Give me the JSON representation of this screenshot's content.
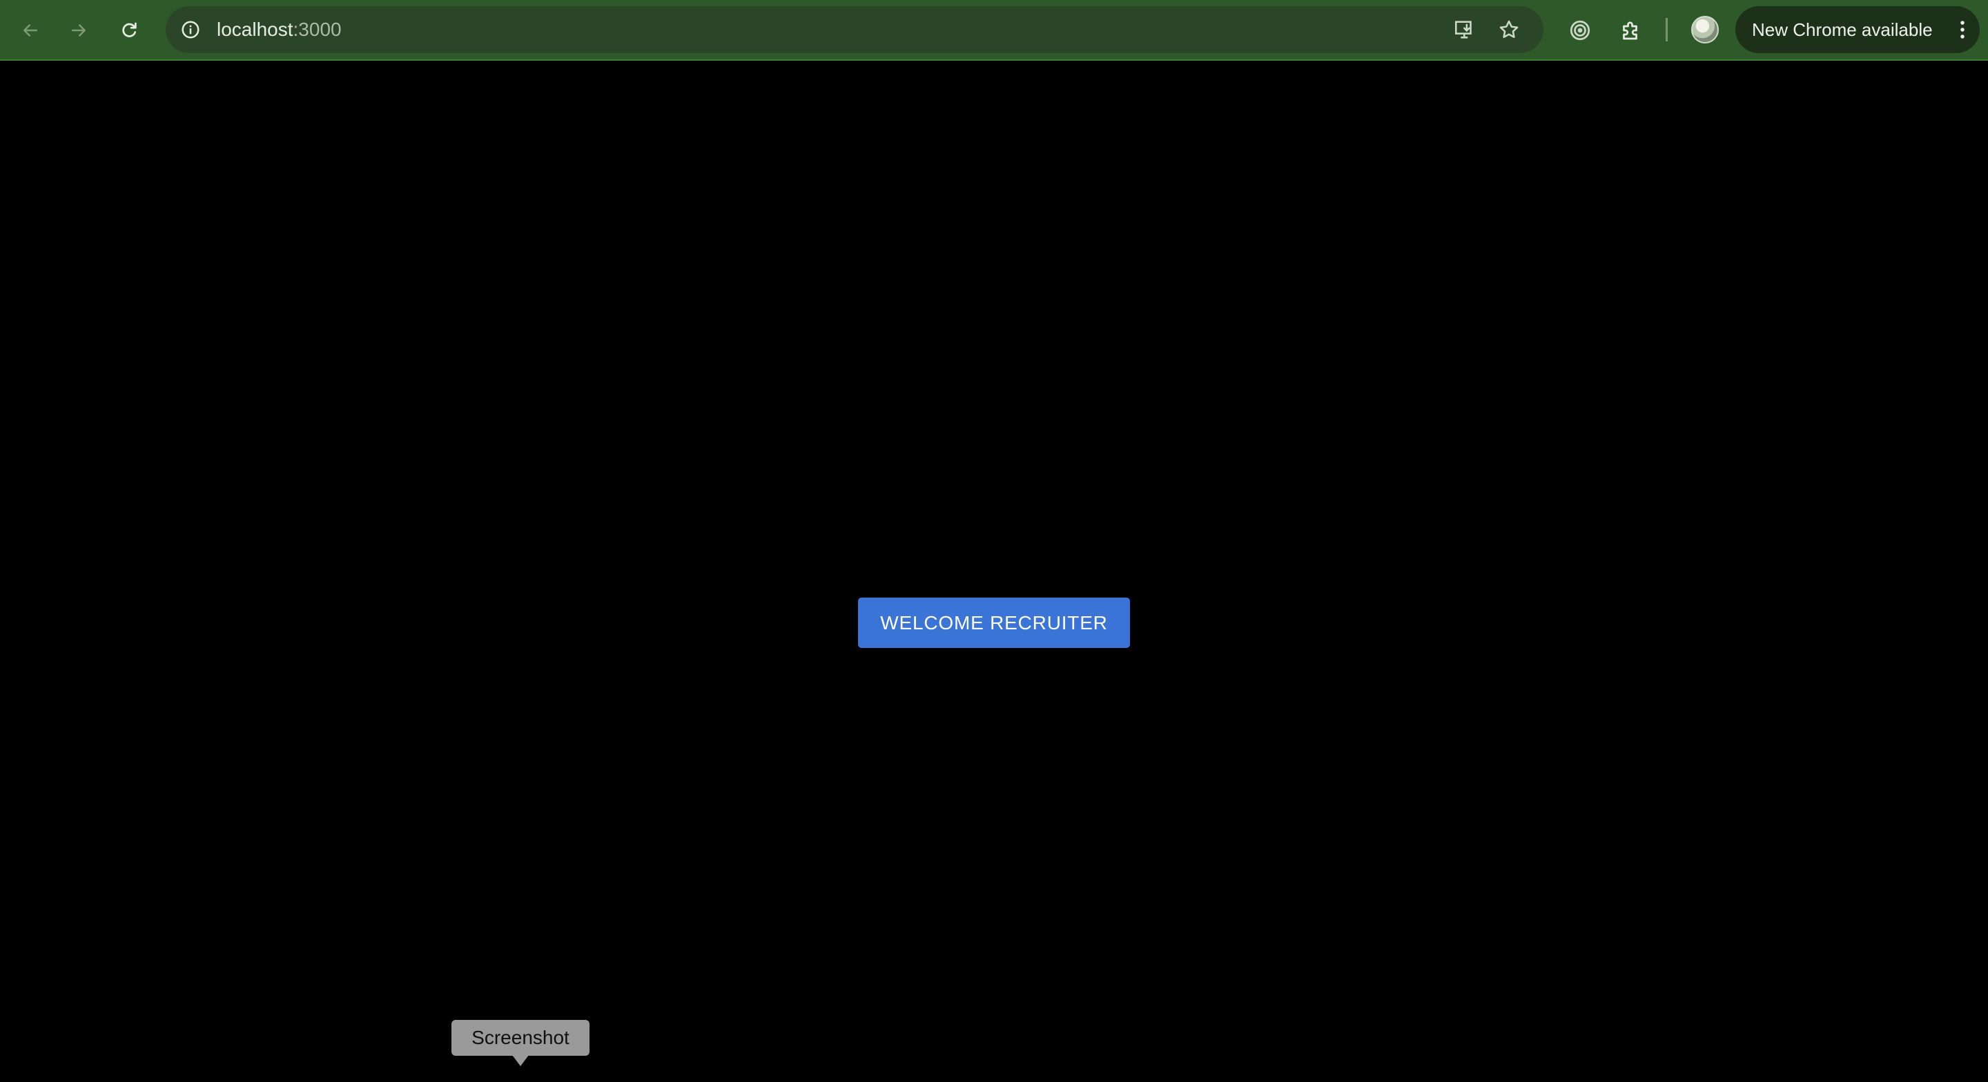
{
  "browser": {
    "url_host": "localhost",
    "url_port": ":3000",
    "update_label": "New Chrome available",
    "toolbar_color": "#2e5a2a",
    "icons": {
      "back": "back-arrow-icon",
      "forward": "forward-arrow-icon",
      "reload": "reload-icon",
      "site_info": "site-info-icon",
      "install": "install-app-icon",
      "bookmark": "bookmark-star-icon",
      "lens": "google-lens-icon",
      "extensions": "extensions-puzzle-icon",
      "menu": "kebab-menu-icon"
    }
  },
  "page": {
    "background": "#000000",
    "welcome_button_label": "WELCOME RECRUITER",
    "welcome_button_color": "#3a74d6"
  },
  "tooltip": {
    "text": "Screenshot"
  }
}
